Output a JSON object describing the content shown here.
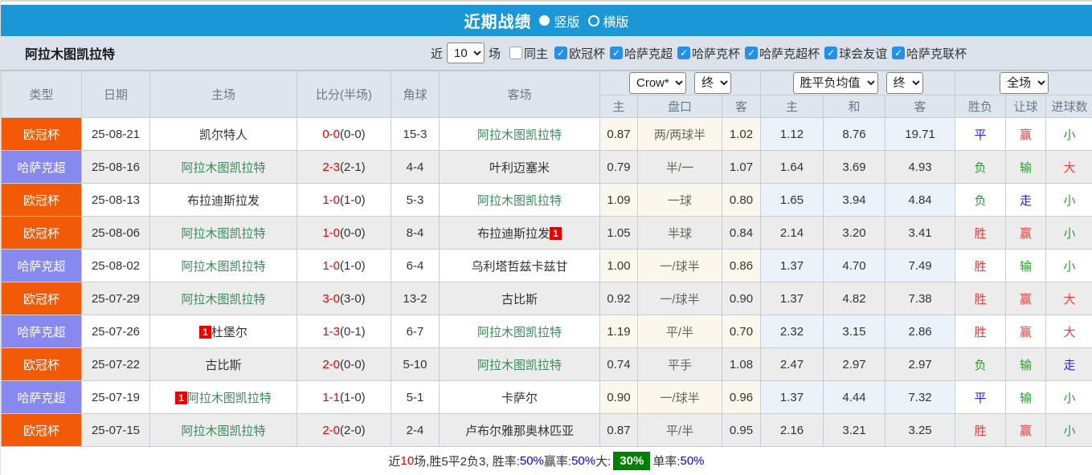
{
  "title_bar": {
    "title": "近期战绩",
    "layout_options": [
      {
        "label": "竖版",
        "selected": true
      },
      {
        "label": "横版",
        "selected": false
      }
    ]
  },
  "filter_bar": {
    "team": "阿拉木图凯拉特",
    "recent_label": "近",
    "recent_count": "10",
    "games_label": "场",
    "same_home": {
      "label": "同主",
      "checked": false
    },
    "leagues": [
      {
        "label": "欧冠杯",
        "checked": true
      },
      {
        "label": "哈萨克超",
        "checked": true
      },
      {
        "label": "哈萨克杯",
        "checked": true
      },
      {
        "label": "哈萨克超杯",
        "checked": true
      },
      {
        "label": "球会友谊",
        "checked": true
      },
      {
        "label": "哈萨克联杯",
        "checked": true
      }
    ]
  },
  "table": {
    "headers": {
      "type": "类型",
      "date": "日期",
      "home": "主场",
      "score": "比分(半场)",
      "corner": "角球",
      "away": "客场"
    },
    "selects": {
      "odds_source": "Crow*",
      "odds_time1": "终",
      "avg_label": "胜平负均值",
      "odds_time2": "终",
      "scope": "全场"
    },
    "sub_headers": [
      "主",
      "盘口",
      "客",
      "主",
      "和",
      "客",
      "胜负",
      "让球",
      "进球数"
    ],
    "rows": [
      {
        "league": "欧冠杯",
        "league_color": "orange",
        "date": "25-08-21",
        "home": {
          "name": "凯尔特人",
          "green": false,
          "badge": "",
          "badge_pos": ""
        },
        "score": "0-0",
        "half": "(0-0)",
        "corners": "15-3",
        "away": {
          "name": "阿拉木图凯拉特",
          "green": true,
          "badge": "",
          "badge_pos": ""
        },
        "odds": [
          "0.87",
          "两/两球半",
          "1.02"
        ],
        "avg": [
          "1.12",
          "8.76",
          "19.71"
        ],
        "results": [
          {
            "text": "平",
            "color": "blue"
          },
          {
            "text": "赢",
            "color": "red"
          },
          {
            "text": "小",
            "color": "green"
          }
        ]
      },
      {
        "league": "哈萨克超",
        "league_color": "purple",
        "date": "25-08-16",
        "home": {
          "name": "阿拉木图凯拉特",
          "green": true,
          "badge": "",
          "badge_pos": ""
        },
        "score": "2-3",
        "half": "(2-1)",
        "corners": "4-4",
        "away": {
          "name": "叶利迈塞米",
          "green": false,
          "badge": "",
          "badge_pos": ""
        },
        "odds": [
          "0.79",
          "半/一",
          "1.07"
        ],
        "avg": [
          "1.64",
          "3.69",
          "4.93"
        ],
        "results": [
          {
            "text": "负",
            "color": "green"
          },
          {
            "text": "输",
            "color": "green"
          },
          {
            "text": "大",
            "color": "red"
          }
        ]
      },
      {
        "league": "欧冠杯",
        "league_color": "orange",
        "date": "25-08-13",
        "home": {
          "name": "布拉迪斯拉发",
          "green": false,
          "badge": "",
          "badge_pos": ""
        },
        "score": "1-0",
        "half": "(1-0)",
        "corners": "5-3",
        "away": {
          "name": "阿拉木图凯拉特",
          "green": true,
          "badge": "",
          "badge_pos": ""
        },
        "odds": [
          "1.09",
          "一球",
          "0.80"
        ],
        "avg": [
          "1.65",
          "3.94",
          "4.84"
        ],
        "results": [
          {
            "text": "负",
            "color": "green"
          },
          {
            "text": "走",
            "color": "blue"
          },
          {
            "text": "小",
            "color": "green"
          }
        ]
      },
      {
        "league": "欧冠杯",
        "league_color": "orange",
        "date": "25-08-06",
        "home": {
          "name": "阿拉木图凯拉特",
          "green": true,
          "badge": "",
          "badge_pos": ""
        },
        "score": "1-0",
        "half": "(0-0)",
        "corners": "8-4",
        "away": {
          "name": "布拉迪斯拉发",
          "green": false,
          "badge": "1",
          "badge_pos": "after"
        },
        "odds": [
          "1.05",
          "半球",
          "0.84"
        ],
        "avg": [
          "2.14",
          "3.20",
          "3.41"
        ],
        "results": [
          {
            "text": "胜",
            "color": "red"
          },
          {
            "text": "赢",
            "color": "red"
          },
          {
            "text": "小",
            "color": "green"
          }
        ]
      },
      {
        "league": "哈萨克超",
        "league_color": "purple",
        "date": "25-08-02",
        "home": {
          "name": "阿拉木图凯拉特",
          "green": true,
          "badge": "",
          "badge_pos": ""
        },
        "score": "1-0",
        "half": "(1-0)",
        "corners": "6-4",
        "away": {
          "name": "乌利塔哲兹卡兹甘",
          "green": false,
          "badge": "",
          "badge_pos": ""
        },
        "odds": [
          "1.00",
          "一/球半",
          "0.86"
        ],
        "avg": [
          "1.37",
          "4.70",
          "7.49"
        ],
        "results": [
          {
            "text": "胜",
            "color": "red"
          },
          {
            "text": "输",
            "color": "green"
          },
          {
            "text": "小",
            "color": "green"
          }
        ]
      },
      {
        "league": "欧冠杯",
        "league_color": "orange",
        "date": "25-07-29",
        "home": {
          "name": "阿拉木图凯拉特",
          "green": true,
          "badge": "",
          "badge_pos": ""
        },
        "score": "3-0",
        "half": "(3-0)",
        "corners": "13-2",
        "away": {
          "name": "古比斯",
          "green": false,
          "badge": "",
          "badge_pos": ""
        },
        "odds": [
          "0.92",
          "一/球半",
          "0.90"
        ],
        "avg": [
          "1.37",
          "4.82",
          "7.38"
        ],
        "results": [
          {
            "text": "胜",
            "color": "red"
          },
          {
            "text": "赢",
            "color": "red"
          },
          {
            "text": "大",
            "color": "red"
          }
        ]
      },
      {
        "league": "哈萨克超",
        "league_color": "purple",
        "date": "25-07-26",
        "home": {
          "name": "杜堡尔",
          "green": false,
          "badge": "1",
          "badge_pos": "before"
        },
        "score": "1-3",
        "half": "(0-1)",
        "corners": "6-7",
        "away": {
          "name": "阿拉木图凯拉特",
          "green": true,
          "badge": "",
          "badge_pos": ""
        },
        "odds": [
          "1.19",
          "平/半",
          "0.70"
        ],
        "avg": [
          "2.32",
          "3.15",
          "2.86"
        ],
        "results": [
          {
            "text": "胜",
            "color": "red"
          },
          {
            "text": "赢",
            "color": "red"
          },
          {
            "text": "大",
            "color": "red"
          }
        ]
      },
      {
        "league": "欧冠杯",
        "league_color": "orange",
        "date": "25-07-22",
        "home": {
          "name": "古比斯",
          "green": false,
          "badge": "",
          "badge_pos": ""
        },
        "score": "2-0",
        "half": "(0-0)",
        "corners": "5-10",
        "away": {
          "name": "阿拉木图凯拉特",
          "green": true,
          "badge": "",
          "badge_pos": ""
        },
        "odds": [
          "0.74",
          "平手",
          "1.08"
        ],
        "avg": [
          "2.47",
          "2.97",
          "2.97"
        ],
        "results": [
          {
            "text": "负",
            "color": "green"
          },
          {
            "text": "输",
            "color": "green"
          },
          {
            "text": "走",
            "color": "blue"
          }
        ]
      },
      {
        "league": "哈萨克超",
        "league_color": "purple",
        "date": "25-07-19",
        "home": {
          "name": "阿拉木图凯拉特",
          "green": true,
          "badge": "1",
          "badge_pos": "before"
        },
        "score": "1-1",
        "half": "(1-0)",
        "corners": "5-1",
        "away": {
          "name": "卡萨尔",
          "green": false,
          "badge": "",
          "badge_pos": ""
        },
        "odds": [
          "0.90",
          "一/球半",
          "0.96"
        ],
        "avg": [
          "1.37",
          "4.44",
          "7.32"
        ],
        "results": [
          {
            "text": "平",
            "color": "blue"
          },
          {
            "text": "输",
            "color": "green"
          },
          {
            "text": "小",
            "color": "green"
          }
        ]
      },
      {
        "league": "欧冠杯",
        "league_color": "orange",
        "date": "25-07-15",
        "home": {
          "name": "阿拉木图凯拉特",
          "green": true,
          "badge": "",
          "badge_pos": ""
        },
        "score": "2-0",
        "half": "(2-0)",
        "corners": "2-4",
        "away": {
          "name": "卢布尔雅那奥林匹亚",
          "green": false,
          "badge": "",
          "badge_pos": ""
        },
        "odds": [
          "0.87",
          "平/半",
          "0.95"
        ],
        "avg": [
          "2.16",
          "3.21",
          "3.25"
        ],
        "results": [
          {
            "text": "胜",
            "color": "red"
          },
          {
            "text": "赢",
            "color": "red"
          },
          {
            "text": "小",
            "color": "green"
          }
        ]
      }
    ]
  },
  "summary": {
    "segments": [
      {
        "text": "近",
        "style": "plain"
      },
      {
        "text": "10",
        "style": "red"
      },
      {
        "text": "场,胜5平2负3, 胜率:",
        "style": "plain"
      },
      {
        "text": "50%",
        "style": "blue"
      },
      {
        "text": " 赢率:",
        "style": "plain"
      },
      {
        "text": "50%",
        "style": "blue"
      },
      {
        "text": " 大:",
        "style": "plain"
      },
      {
        "text": "30%",
        "style": "badge"
      },
      {
        "text": " 单率:",
        "style": "plain"
      },
      {
        "text": "50%",
        "style": "blue"
      }
    ]
  },
  "colors": {
    "accent_blue": "#1b97d5",
    "league_orange": "#f25a05",
    "league_purple": "#8789ef",
    "team_green": "#3a8a5a",
    "score_red": "#e60000",
    "badge_green": "#008000"
  }
}
